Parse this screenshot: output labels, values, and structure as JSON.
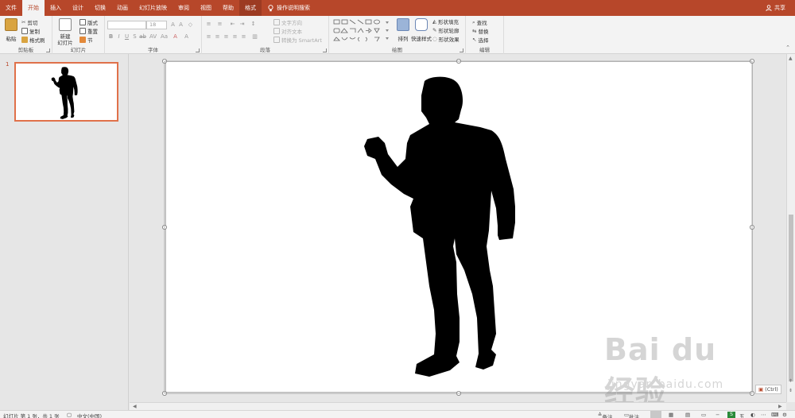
{
  "tabs": [
    "文件",
    "开始",
    "插入",
    "设计",
    "切换",
    "动画",
    "幻灯片放映",
    "审阅",
    "视图",
    "帮助",
    "格式"
  ],
  "tell_me": "操作说明搜索",
  "share": "共享",
  "clipboard": {
    "paste": "粘贴",
    "cut": "剪切",
    "copy": "复制",
    "format_painter": "格式刷",
    "label": "剪贴板"
  },
  "slides_group": {
    "new_slide": "新建\n幻灯片",
    "layout": "版式",
    "reset": "重置",
    "section": "节",
    "label": "幻灯片"
  },
  "font_group": {
    "font_name": "",
    "font_size": "18",
    "label": "字体"
  },
  "paragraph_group": {
    "text_direction": "文字方向",
    "align_text": "对齐文本",
    "convert_smartart": "转换为 SmartArt",
    "label": "段落"
  },
  "drawing_group": {
    "arrange": "排列",
    "quick_styles": "快速样式",
    "shape_fill": "形状填充",
    "shape_outline": "形状轮廓",
    "shape_effects": "形状效果",
    "label": "绘图"
  },
  "editing_group": {
    "find": "查找",
    "replace": "替换",
    "select": "选择",
    "label": "编辑"
  },
  "thumbnail": {
    "number": "1"
  },
  "paste_options": "(Ctrl)",
  "status": {
    "slide_info": "幻灯片 第 1 张，共 1 张",
    "language": "中文(中国)",
    "notes": "备注",
    "comments": "批注"
  },
  "watermark": {
    "main": "Bai du 经验",
    "sub": "jingyan.baidu.com"
  },
  "colors": {
    "accent": "#b7472a",
    "thumb_border": "#e0714a"
  }
}
